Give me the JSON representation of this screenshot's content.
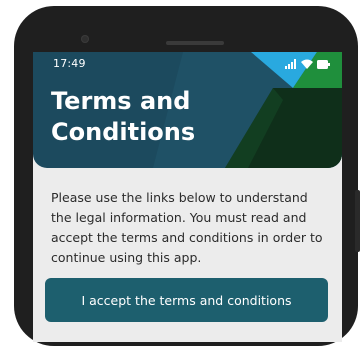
{
  "status_bar": {
    "time": "17:49",
    "icons": [
      "signal-icon",
      "wifi-icon",
      "battery-icon"
    ]
  },
  "header": {
    "title": "Terms and Conditions"
  },
  "content": {
    "intro": "Please use the links below to understand the legal information. You must read and accept the terms and conditions in order to continue using this app."
  },
  "actions": {
    "accept_label": "I accept the terms and conditions"
  },
  "colors": {
    "header_bg": "#1c4a5e",
    "accent_cyan": "#29a9df",
    "accent_green": "#1f8f3c",
    "accent_dark_green": "#0f2f1a",
    "button_bg": "#1d5f6e",
    "screen_bg": "#ececec"
  }
}
